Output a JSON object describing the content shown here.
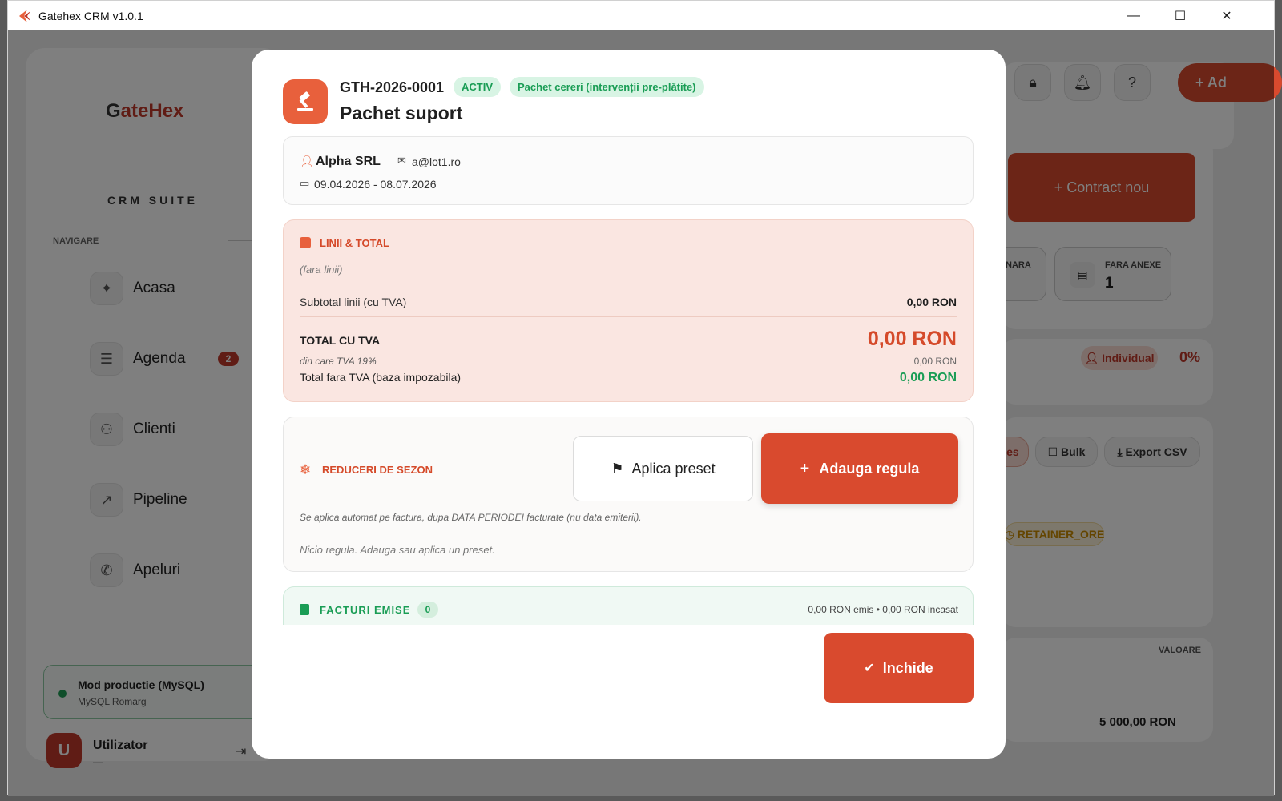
{
  "window": {
    "title": "Gatehex CRM v1.0.1",
    "minimize": "—",
    "maximize": "☐",
    "close": "✕"
  },
  "sidebar": {
    "brand_prefix": "G",
    "brand_rest": "ateHex",
    "suite": "CRM SUITE",
    "nav_label": "NAVIGARE",
    "items": [
      {
        "label": "Acasa",
        "icon": "sparkles-icon"
      },
      {
        "label": "Agenda",
        "icon": "checklist-icon",
        "badge": "2"
      },
      {
        "label": "Clienti",
        "icon": "users-icon"
      },
      {
        "label": "Pipeline",
        "icon": "trend-up-icon"
      },
      {
        "label": "Apeluri",
        "icon": "phone-icon"
      }
    ],
    "db": {
      "title": "Mod productie (MySQL)",
      "subtitle": "MySQL Romarg"
    },
    "user": {
      "initial": "U",
      "name": "Utilizator",
      "role": "—"
    }
  },
  "background": {
    "add_button": "+  Ad",
    "contract_button": "+   Contract nou",
    "stat_partial": "NARA",
    "stat_label": "FARA ANEXE",
    "stat_value": "1",
    "individual_badge": "Individual",
    "percent": "0%",
    "fees_partial": "ces",
    "bulk_button": "Bulk",
    "export_button": "Export CSV",
    "retainer_badge": "RETAINER_ORE",
    "value_header": "VALOARE",
    "value_amount": "5 000,00 RON"
  },
  "modal": {
    "code": "GTH-2026-0001",
    "status": "ACTIV",
    "type": "Pachet cereri (intervenții pre-plătite)",
    "title": "Pachet suport",
    "client": {
      "name": "Alpha SRL",
      "email": "a@lot1.ro",
      "period": "09.04.2026 - 08.07.2026"
    },
    "lines": {
      "heading": "LINII & TOTAL",
      "empty": "(fara linii)",
      "subtotal_label": "Subtotal linii (cu TVA)",
      "subtotal_value": "0,00 RON",
      "total_label": "TOTAL CU TVA",
      "total_value": "0,00 RON",
      "tva_label": "din care TVA 19%",
      "tva_value": "0,00 RON",
      "net_label": "Total fara TVA (baza impozabila)",
      "net_value": "0,00 RON"
    },
    "discounts": {
      "heading": "REDUCERI DE SEZON",
      "preset_button": "Aplica preset",
      "add_button": "Adauga regula",
      "note": "Se aplica automat pe factura, dupa DATA PERIODEI facturate (nu data emiterii).",
      "empty": "Nicio regula. Adauga sau aplica un preset."
    },
    "invoices": {
      "heading": "FACTURI EMISE",
      "count": "0",
      "summary": "0,00 RON emis  •  0,00 RON incasat"
    },
    "close_button": "Inchide"
  }
}
